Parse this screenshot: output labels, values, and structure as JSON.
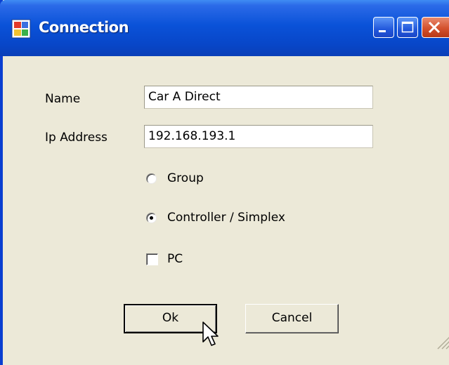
{
  "window": {
    "title": "Connection"
  },
  "form": {
    "name_label": "Name",
    "name_value": "Car A Direct",
    "ip_label": "Ip Address",
    "ip_value": "192.168.193.1",
    "options": {
      "group_label": "Group",
      "group_selected": false,
      "controller_label": "Controller / Simplex",
      "controller_selected": true,
      "pc_label": "PC",
      "pc_checked": false
    }
  },
  "buttons": {
    "ok_label": "Ok",
    "cancel_label": "Cancel"
  },
  "colors": {
    "titlebar": "#0a52d8",
    "face": "#ece9d8",
    "close": "#d4512d"
  }
}
